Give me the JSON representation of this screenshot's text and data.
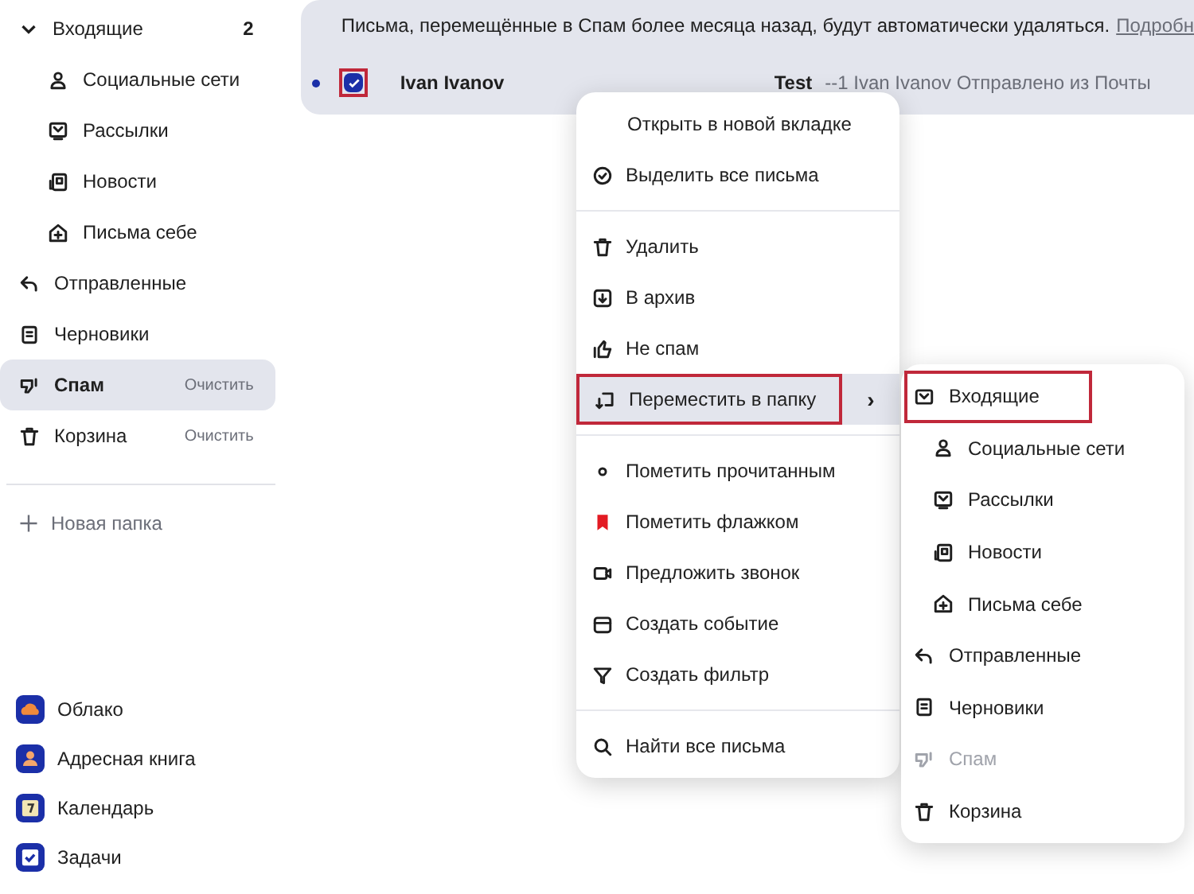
{
  "sidebar": {
    "folders": [
      {
        "label": "Входящие",
        "count": "2",
        "expanded": true,
        "selected": false,
        "children": [
          {
            "label": "Социальные сети",
            "kind": "social",
            "selected": false
          },
          {
            "label": "Рассылки",
            "kind": "newsletters",
            "selected": false
          },
          {
            "label": "Новости",
            "kind": "news",
            "selected": false
          },
          {
            "label": "Письма себе",
            "kind": "self",
            "selected": false
          }
        ]
      },
      {
        "label": "Отправленные",
        "kind": "sent",
        "selected": false
      },
      {
        "label": "Черновики",
        "kind": "drafts",
        "selected": false
      },
      {
        "label": "Спам",
        "kind": "spam",
        "selected": true,
        "action": "Очистить"
      },
      {
        "label": "Корзина",
        "kind": "trash",
        "selected": false,
        "action": "Очистить"
      }
    ],
    "new_folder": "Новая папка",
    "apps": [
      {
        "label": "Облако",
        "kind": "cloud"
      },
      {
        "label": "Адресная книга",
        "kind": "contacts"
      },
      {
        "label": "Календарь",
        "kind": "calendar"
      },
      {
        "label": "Задачи",
        "kind": "tasks"
      }
    ]
  },
  "notice": {
    "text": "Письма, перемещённые в Спам более месяца назад, будут автоматически удаляться.",
    "link": "Подробн"
  },
  "messages": [
    {
      "unread": true,
      "checked": true,
      "highlighted": true,
      "sender": "Ivan Ivanov",
      "subject": "Test",
      "snippet": "--1 Ivan Ivanov Отправлено из Почты"
    }
  ],
  "context_menu": {
    "groups": [
      [
        {
          "label": "Открыть в новой вкладке",
          "kind": "none",
          "selected": false,
          "highlighted": false
        },
        {
          "label": "Выделить все письма",
          "kind": "selectall",
          "selected": false,
          "highlighted": false
        }
      ],
      [
        {
          "label": "Удалить",
          "kind": "trash",
          "selected": false,
          "highlighted": false
        },
        {
          "label": "В архив",
          "kind": "archive",
          "selected": false,
          "highlighted": false
        },
        {
          "label": "Не спам",
          "kind": "notspam",
          "selected": false,
          "highlighted": false
        },
        {
          "label": "Переместить в папку",
          "kind": "move",
          "selected": true,
          "highlighted": true,
          "arrow": "›"
        }
      ],
      [
        {
          "label": "Пометить прочитанным",
          "kind": "read",
          "selected": false,
          "highlighted": false
        },
        {
          "label": "Пометить флажком",
          "kind": "flag",
          "selected": false,
          "highlighted": false
        },
        {
          "label": "Предложить звонок",
          "kind": "call",
          "selected": false,
          "highlighted": false
        },
        {
          "label": "Создать событие",
          "kind": "event",
          "selected": false,
          "highlighted": false
        },
        {
          "label": "Создать фильтр",
          "kind": "filter",
          "selected": false,
          "highlighted": false
        }
      ],
      [
        {
          "label": "Найти все письма",
          "kind": "search",
          "selected": false,
          "highlighted": false
        }
      ]
    ]
  },
  "submenu": {
    "folders": [
      {
        "label": "Входящие",
        "kind": "inbox",
        "disabled": false,
        "highlighted": true,
        "children": [
          {
            "label": "Социальные сети",
            "kind": "social",
            "disabled": false,
            "highlighted": false
          },
          {
            "label": "Рассылки",
            "kind": "newsletters",
            "disabled": false,
            "highlighted": false
          },
          {
            "label": "Новости",
            "kind": "news",
            "disabled": false,
            "highlighted": false
          },
          {
            "label": "Письма себе",
            "kind": "self",
            "disabled": false,
            "highlighted": false
          }
        ]
      },
      {
        "label": "Отправленные",
        "kind": "sent",
        "disabled": false,
        "highlighted": false
      },
      {
        "label": "Черновики",
        "kind": "drafts",
        "disabled": false,
        "highlighted": false
      },
      {
        "label": "Спам",
        "kind": "spam",
        "disabled": true,
        "highlighted": false
      },
      {
        "label": "Корзина",
        "kind": "trash",
        "disabled": false,
        "highlighted": false
      }
    ]
  }
}
